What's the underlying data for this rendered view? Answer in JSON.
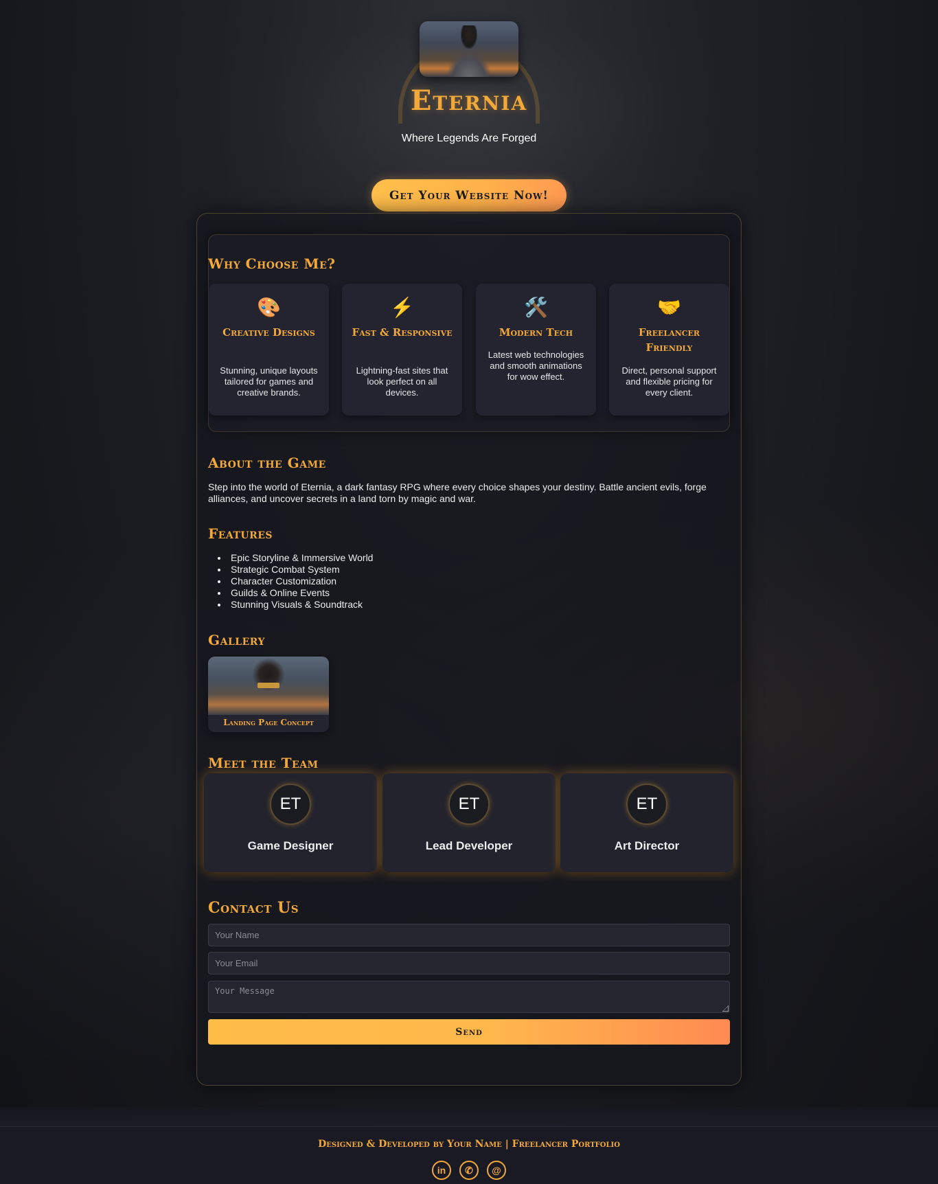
{
  "header": {
    "title": "Eternia",
    "tagline": "Where Legends Are Forged",
    "cta_label": "Get Your Website Now!"
  },
  "why": {
    "title": "Why Choose Me?",
    "cards": [
      {
        "icon": "palette-icon",
        "glyph": "🎨",
        "title": "Creative Designs",
        "desc": "Stunning, unique layouts tailored for games and creative brands."
      },
      {
        "icon": "lightning-icon",
        "glyph": "⚡",
        "title": "Fast & Responsive",
        "desc": "Lightning-fast sites that look perfect on all devices."
      },
      {
        "icon": "tools-icon",
        "glyph": "🛠️",
        "title": "Modern Tech",
        "desc": "Latest web technologies and smooth animations for wow effect."
      },
      {
        "icon": "handshake-icon",
        "glyph": "🤝",
        "title": "Freelancer Friendly",
        "desc": "Direct, personal support and flexible pricing for every client."
      }
    ]
  },
  "about": {
    "title": "About the Game",
    "text": "Step into the world of Eternia, a dark fantasy RPG where every choice shapes your destiny. Battle ancient evils, forge alliances, and uncover secrets in a land torn by magic and war."
  },
  "features": {
    "title": "Features",
    "items": [
      "Epic Storyline & Immersive World",
      "Strategic Combat System",
      "Character Customization",
      "Guilds & Online Events",
      "Stunning Visuals & Soundtrack"
    ]
  },
  "gallery": {
    "title": "Gallery",
    "items": [
      {
        "caption": "Landing Page Concept"
      }
    ]
  },
  "team": {
    "title": "Meet the Team",
    "members": [
      {
        "initials": "ET",
        "role": "Game Designer"
      },
      {
        "initials": "ET",
        "role": "Lead Developer"
      },
      {
        "initials": "ET",
        "role": "Art Director"
      }
    ]
  },
  "contact": {
    "title": "Contact Us",
    "name_placeholder": "Your Name",
    "email_placeholder": "Your Email",
    "message_placeholder": "Your Message",
    "send_label": "Send"
  },
  "footer": {
    "text": "Designed & Developed by Your Name | Freelancer Portfolio",
    "social": [
      {
        "icon": "linkedin-icon",
        "glyph": "in"
      },
      {
        "icon": "whatsapp-icon",
        "glyph": "✆"
      },
      {
        "icon": "email-icon",
        "glyph": "@"
      }
    ]
  },
  "colors": {
    "accent": "#f3a93a",
    "cta_gradient_start": "#ffc04a",
    "cta_gradient_end": "#ff8a52",
    "card_bg": "#23242f",
    "page_bg": "#17181d"
  }
}
